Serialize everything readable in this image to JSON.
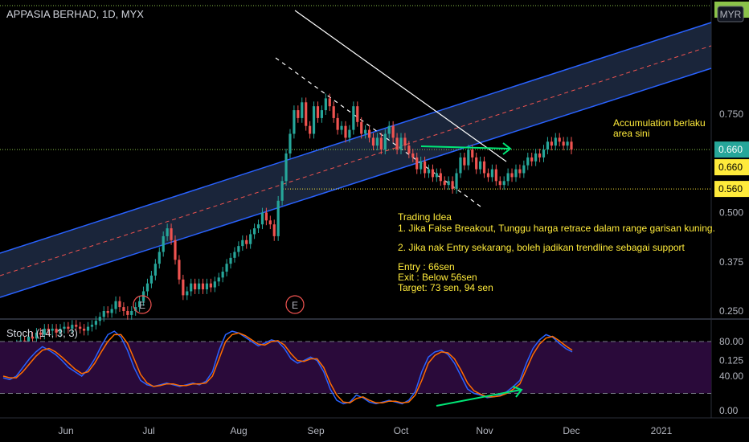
{
  "header": {
    "symbol_title": "APPASIA BERHAD, 1D, MYX",
    "currency": "MYR"
  },
  "price_labels": {
    "top_cut": "0.810",
    "last": "0.660",
    "level_1": "0.660",
    "level_2": "0.560"
  },
  "annotations": {
    "accumulation": [
      "Accumulation berlaku",
      "area sini"
    ],
    "trading_idea": [
      "Trading Idea",
      "1. Jika False Breakout, Tunggu harga retrace dalam range garisan kuning.",
      "",
      "2. Jika nak Entry sekarang, boleh jadikan trendline sebagai support",
      "",
      "Entry : 66sen",
      "Exit : Below 56sen",
      "Target: 73 sen, 94 sen"
    ],
    "earnings_marker": "E"
  },
  "stoch_panel": {
    "title": "Stoch (14, 3, 3)",
    "upper_band": 80,
    "lower_band": 20
  },
  "colors": {
    "up": "#26a69a",
    "down": "#ef5350",
    "channel": "#2962ff",
    "yellow": "#ffeb3b",
    "green_arrow": "#00e676",
    "k_line": "#2962ff",
    "d_line": "#ff6d00",
    "stoch_fill": "#2a0a3a",
    "last_bg": "#26a69a"
  },
  "chart_data": [
    {
      "type": "candlestick",
      "title": "APPASIA BERHAD, 1D, MYX",
      "x_ticks": [
        "Jun",
        "Jul",
        "Aug",
        "Sep",
        "Oct",
        "Nov",
        "Dec",
        "2021"
      ],
      "y_ticks": [
        0.125,
        0.25,
        0.375,
        0.5,
        0.75
      ],
      "ylim": [
        0.11,
        0.83
      ],
      "grid": false,
      "candles": [
        {
          "o": 0.15,
          "c": 0.155
        },
        {
          "o": 0.155,
          "c": 0.15
        },
        {
          "o": 0.15,
          "c": 0.16
        },
        {
          "o": 0.16,
          "c": 0.165
        },
        {
          "o": 0.165,
          "c": 0.175
        },
        {
          "o": 0.175,
          "c": 0.17
        },
        {
          "o": 0.17,
          "c": 0.185
        },
        {
          "o": 0.185,
          "c": 0.18
        },
        {
          "o": 0.18,
          "c": 0.195
        },
        {
          "o": 0.195,
          "c": 0.19
        },
        {
          "o": 0.19,
          "c": 0.205
        },
        {
          "o": 0.205,
          "c": 0.2
        },
        {
          "o": 0.2,
          "c": 0.205
        },
        {
          "o": 0.205,
          "c": 0.195
        },
        {
          "o": 0.195,
          "c": 0.205
        },
        {
          "o": 0.205,
          "c": 0.21
        },
        {
          "o": 0.21,
          "c": 0.205
        },
        {
          "o": 0.205,
          "c": 0.215
        },
        {
          "o": 0.215,
          "c": 0.21
        },
        {
          "o": 0.21,
          "c": 0.205
        },
        {
          "o": 0.205,
          "c": 0.2
        },
        {
          "o": 0.2,
          "c": 0.21
        },
        {
          "o": 0.21,
          "c": 0.215
        },
        {
          "o": 0.215,
          "c": 0.225
        },
        {
          "o": 0.225,
          "c": 0.235
        },
        {
          "o": 0.235,
          "c": 0.25
        },
        {
          "o": 0.25,
          "c": 0.245
        },
        {
          "o": 0.245,
          "c": 0.255
        },
        {
          "o": 0.255,
          "c": 0.275
        },
        {
          "o": 0.275,
          "c": 0.26
        },
        {
          "o": 0.26,
          "c": 0.25
        },
        {
          "o": 0.25,
          "c": 0.24
        },
        {
          "o": 0.24,
          "c": 0.25
        },
        {
          "o": 0.25,
          "c": 0.26
        },
        {
          "o": 0.26,
          "c": 0.275
        },
        {
          "o": 0.275,
          "c": 0.3
        },
        {
          "o": 0.3,
          "c": 0.32
        },
        {
          "o": 0.32,
          "c": 0.34
        },
        {
          "o": 0.34,
          "c": 0.37
        },
        {
          "o": 0.37,
          "c": 0.4
        },
        {
          "o": 0.4,
          "c": 0.44
        },
        {
          "o": 0.44,
          "c": 0.46
        },
        {
          "o": 0.46,
          "c": 0.43
        },
        {
          "o": 0.43,
          "c": 0.38
        },
        {
          "o": 0.38,
          "c": 0.33
        },
        {
          "o": 0.33,
          "c": 0.29
        },
        {
          "o": 0.29,
          "c": 0.3
        },
        {
          "o": 0.3,
          "c": 0.32
        },
        {
          "o": 0.32,
          "c": 0.305
        },
        {
          "o": 0.305,
          "c": 0.32
        },
        {
          "o": 0.32,
          "c": 0.305
        },
        {
          "o": 0.305,
          "c": 0.32
        },
        {
          "o": 0.32,
          "c": 0.31
        },
        {
          "o": 0.31,
          "c": 0.325
        },
        {
          "o": 0.325,
          "c": 0.335
        },
        {
          "o": 0.335,
          "c": 0.35
        },
        {
          "o": 0.35,
          "c": 0.37
        },
        {
          "o": 0.37,
          "c": 0.385
        },
        {
          "o": 0.385,
          "c": 0.4
        },
        {
          "o": 0.4,
          "c": 0.415
        },
        {
          "o": 0.415,
          "c": 0.43
        },
        {
          "o": 0.43,
          "c": 0.42
        },
        {
          "o": 0.42,
          "c": 0.445
        },
        {
          "o": 0.445,
          "c": 0.46
        },
        {
          "o": 0.46,
          "c": 0.47
        },
        {
          "o": 0.47,
          "c": 0.5
        },
        {
          "o": 0.5,
          "c": 0.48
        },
        {
          "o": 0.48,
          "c": 0.47
        },
        {
          "o": 0.47,
          "c": 0.44
        },
        {
          "o": 0.44,
          "c": 0.53
        },
        {
          "o": 0.53,
          "c": 0.58
        },
        {
          "o": 0.58,
          "c": 0.65
        },
        {
          "o": 0.65,
          "c": 0.7
        },
        {
          "o": 0.7,
          "c": 0.76
        },
        {
          "o": 0.76,
          "c": 0.74
        },
        {
          "o": 0.74,
          "c": 0.78
        },
        {
          "o": 0.78,
          "c": 0.72
        },
        {
          "o": 0.72,
          "c": 0.7
        },
        {
          "o": 0.7,
          "c": 0.77
        },
        {
          "o": 0.77,
          "c": 0.74
        },
        {
          "o": 0.74,
          "c": 0.76
        },
        {
          "o": 0.76,
          "c": 0.79
        },
        {
          "o": 0.79,
          "c": 0.77
        },
        {
          "o": 0.77,
          "c": 0.74
        },
        {
          "o": 0.74,
          "c": 0.71
        },
        {
          "o": 0.71,
          "c": 0.72
        },
        {
          "o": 0.72,
          "c": 0.69
        },
        {
          "o": 0.69,
          "c": 0.71
        },
        {
          "o": 0.71,
          "c": 0.77
        },
        {
          "o": 0.77,
          "c": 0.73
        },
        {
          "o": 0.73,
          "c": 0.7
        },
        {
          "o": 0.7,
          "c": 0.71
        },
        {
          "o": 0.71,
          "c": 0.69
        },
        {
          "o": 0.69,
          "c": 0.67
        },
        {
          "o": 0.67,
          "c": 0.69
        },
        {
          "o": 0.69,
          "c": 0.66
        },
        {
          "o": 0.66,
          "c": 0.7
        },
        {
          "o": 0.7,
          "c": 0.72
        },
        {
          "o": 0.72,
          "c": 0.69
        },
        {
          "o": 0.69,
          "c": 0.66
        },
        {
          "o": 0.66,
          "c": 0.69
        },
        {
          "o": 0.69,
          "c": 0.67
        },
        {
          "o": 0.67,
          "c": 0.65
        },
        {
          "o": 0.65,
          "c": 0.64
        },
        {
          "o": 0.64,
          "c": 0.61
        },
        {
          "o": 0.61,
          "c": 0.63
        },
        {
          "o": 0.63,
          "c": 0.6
        },
        {
          "o": 0.6,
          "c": 0.61
        },
        {
          "o": 0.61,
          "c": 0.59
        },
        {
          "o": 0.59,
          "c": 0.6
        },
        {
          "o": 0.6,
          "c": 0.58
        },
        {
          "o": 0.58,
          "c": 0.57
        },
        {
          "o": 0.57,
          "c": 0.58
        },
        {
          "o": 0.58,
          "c": 0.56
        },
        {
          "o": 0.56,
          "c": 0.6
        },
        {
          "o": 0.6,
          "c": 0.64
        },
        {
          "o": 0.64,
          "c": 0.62
        },
        {
          "o": 0.62,
          "c": 0.66
        },
        {
          "o": 0.66,
          "c": 0.64
        },
        {
          "o": 0.64,
          "c": 0.61
        },
        {
          "o": 0.61,
          "c": 0.63
        },
        {
          "o": 0.63,
          "c": 0.6
        },
        {
          "o": 0.6,
          "c": 0.59
        },
        {
          "o": 0.59,
          "c": 0.61
        },
        {
          "o": 0.61,
          "c": 0.58
        },
        {
          "o": 0.58,
          "c": 0.57
        },
        {
          "o": 0.57,
          "c": 0.58
        },
        {
          "o": 0.58,
          "c": 0.6
        },
        {
          "o": 0.6,
          "c": 0.59
        },
        {
          "o": 0.59,
          "c": 0.61
        },
        {
          "o": 0.61,
          "c": 0.6
        },
        {
          "o": 0.6,
          "c": 0.62
        },
        {
          "o": 0.62,
          "c": 0.64
        },
        {
          "o": 0.64,
          "c": 0.63
        },
        {
          "o": 0.63,
          "c": 0.65
        },
        {
          "o": 0.65,
          "c": 0.64
        },
        {
          "o": 0.64,
          "c": 0.66
        },
        {
          "o": 0.66,
          "c": 0.68
        },
        {
          "o": 0.68,
          "c": 0.67
        },
        {
          "o": 0.67,
          "c": 0.69
        },
        {
          "o": 0.69,
          "c": 0.68
        },
        {
          "o": 0.68,
          "c": 0.67
        },
        {
          "o": 0.67,
          "c": 0.68
        },
        {
          "o": 0.68,
          "c": 0.66
        }
      ]
    },
    {
      "type": "line",
      "title": "Stoch (14, 3, 3)",
      "y_ticks": [
        0,
        40,
        80
      ],
      "ylim": [
        -5,
        105
      ],
      "series": [
        {
          "name": "%K",
          "values": [
            38,
            36,
            40,
            50,
            60,
            68,
            74,
            70,
            65,
            58,
            50,
            45,
            40,
            48,
            60,
            75,
            88,
            92,
            85,
            70,
            50,
            35,
            30,
            28,
            30,
            32,
            30,
            28,
            30,
            32,
            30,
            34,
            45,
            70,
            88,
            92,
            90,
            85,
            80,
            75,
            78,
            82,
            80,
            72,
            60,
            55,
            58,
            62,
            58,
            45,
            25,
            12,
            8,
            10,
            18,
            15,
            10,
            8,
            10,
            12,
            10,
            8,
            12,
            22,
            45,
            62,
            68,
            70,
            65,
            55,
            40,
            25,
            20,
            18,
            15,
            16,
            18,
            22,
            28,
            35,
            55,
            72,
            82,
            88,
            85,
            78,
            72,
            68
          ]
        },
        {
          "name": "%D",
          "values": [
            40,
            38,
            38,
            45,
            54,
            63,
            70,
            72,
            68,
            62,
            55,
            48,
            43,
            45,
            55,
            68,
            80,
            88,
            88,
            78,
            60,
            42,
            32,
            28,
            29,
            31,
            31,
            29,
            29,
            31,
            31,
            32,
            40,
            60,
            80,
            88,
            90,
            87,
            82,
            77,
            76,
            80,
            81,
            76,
            66,
            58,
            57,
            60,
            60,
            50,
            32,
            18,
            10,
            9,
            14,
            16,
            12,
            9,
            9,
            11,
            11,
            9,
            10,
            18,
            35,
            55,
            64,
            68,
            67,
            60,
            47,
            32,
            23,
            19,
            16,
            16,
            17,
            20,
            25,
            31,
            48,
            65,
            77,
            84,
            86,
            81,
            75,
            70
          ]
        }
      ]
    }
  ]
}
